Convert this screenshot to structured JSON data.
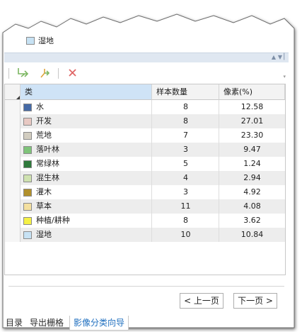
{
  "top_item": {
    "label": "湿地",
    "color": "#c7e2f4"
  },
  "toolbar": {
    "buttons": [
      {
        "icon": "merge-classes-icon",
        "color": "#7bb661"
      },
      {
        "icon": "split-class-icon",
        "color": "#e0a33c"
      },
      {
        "icon": "delete-icon",
        "color": "#e06666"
      }
    ]
  },
  "table": {
    "columns": [
      "类",
      "样本数量",
      "像素(%)"
    ],
    "rows": [
      {
        "name": "水",
        "color": "#466aa6",
        "count": "8",
        "percent": "12.58"
      },
      {
        "name": "开发",
        "color": "#e8c9c3",
        "count": "8",
        "percent": "27.01"
      },
      {
        "name": "荒地",
        "color": "#d2cdc0",
        "count": "7",
        "percent": "23.30"
      },
      {
        "name": "落叶林",
        "color": "#7fc47a",
        "count": "3",
        "percent": "9.47"
      },
      {
        "name": "常绿林",
        "color": "#2f7a3c",
        "count": "5",
        "percent": "1.24"
      },
      {
        "name": "混生林",
        "color": "#cfe2b0",
        "count": "4",
        "percent": "2.94"
      },
      {
        "name": "灌木",
        "color": "#b1902c",
        "count": "3",
        "percent": "4.92"
      },
      {
        "name": "草本",
        "color": "#f4e0a0",
        "count": "11",
        "percent": "4.08"
      },
      {
        "name": "种植/耕种",
        "color": "#f5f146",
        "count": "8",
        "percent": "3.62"
      },
      {
        "name": "湿地",
        "color": "#c7e2f4",
        "count": "10",
        "percent": "10.84"
      }
    ]
  },
  "nav": {
    "prev_label": "< 上一页",
    "next_label": "下一页 >"
  },
  "tabs": [
    {
      "label": "目录",
      "active": false
    },
    {
      "label": "导出栅格",
      "active": false
    },
    {
      "label": "影像分类向导",
      "active": true
    }
  ]
}
